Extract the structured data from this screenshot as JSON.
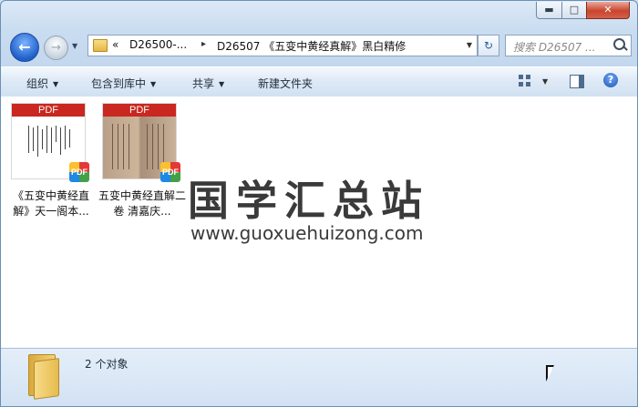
{
  "window": {
    "buttons": {
      "minimize": "▬",
      "maximize": "□",
      "close": "✕"
    }
  },
  "nav": {
    "back_glyph": "←",
    "forward_glyph": "→",
    "dropdown_glyph": "▼",
    "address": {
      "overflow": "«",
      "crumbs": [
        "D26500-...",
        "D26507 《五变中黄经真解》黑白精修"
      ],
      "separator": "▸"
    },
    "refresh_glyph": "↻",
    "search_placeholder": "搜索 D26507 ..."
  },
  "toolbar": {
    "organize": "组织",
    "include_in_library": "包含到库中",
    "share": "共享",
    "new_folder": "新建文件夹",
    "help_glyph": "?"
  },
  "files": [
    {
      "label": "《五变中黄经直解》天一阁本...",
      "badge": "PDF",
      "header": "PDF"
    },
    {
      "label": "五变中黄经直解二卷 清嘉庆...",
      "badge": "PDF",
      "header": "PDF"
    }
  ],
  "watermark": {
    "title": "国学汇总站",
    "url": "www.guoxuehuizong.com"
  },
  "status": {
    "count_text": "2 个对象"
  },
  "colors": {
    "pdf_red": "#c9271f",
    "window_frame": "#6b8fb5",
    "close_red": "#c9452c"
  }
}
